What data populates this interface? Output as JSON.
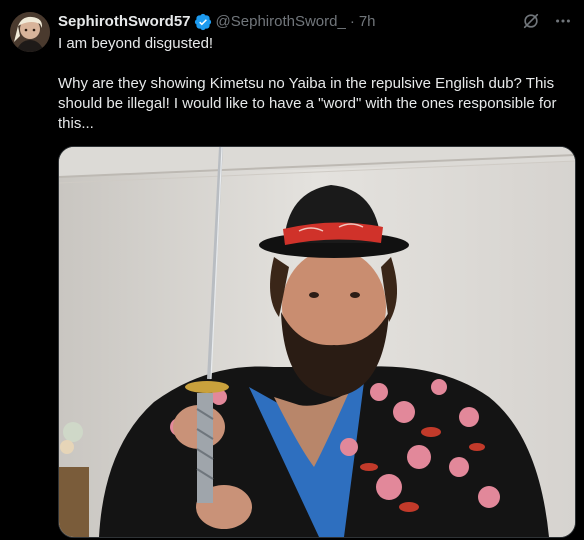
{
  "tweet": {
    "author": {
      "display_name": "SephirothSword57",
      "handle": "@SephirothSword_",
      "verified": true,
      "verified_icon": "verified-badge-icon",
      "avatar_icon": "avatar"
    },
    "separator": "·",
    "timestamp": "7h",
    "text_paragraphs": [
      "I am beyond disgusted!",
      "Why are they showing Kimetsu no Yaiba in the repulsive English dub? This should be illegal! I would like to have a \"word\" with the ones responsible for this..."
    ],
    "actions": {
      "grok_icon": "grok-icon",
      "more_icon": "more-options-icon"
    },
    "media": {
      "type": "photo"
    }
  },
  "colors": {
    "background": "#000000",
    "text_primary": "#e7e9ea",
    "text_secondary": "#71767b",
    "verified_blue": "#1d9bf0",
    "border": "#2f3336"
  }
}
